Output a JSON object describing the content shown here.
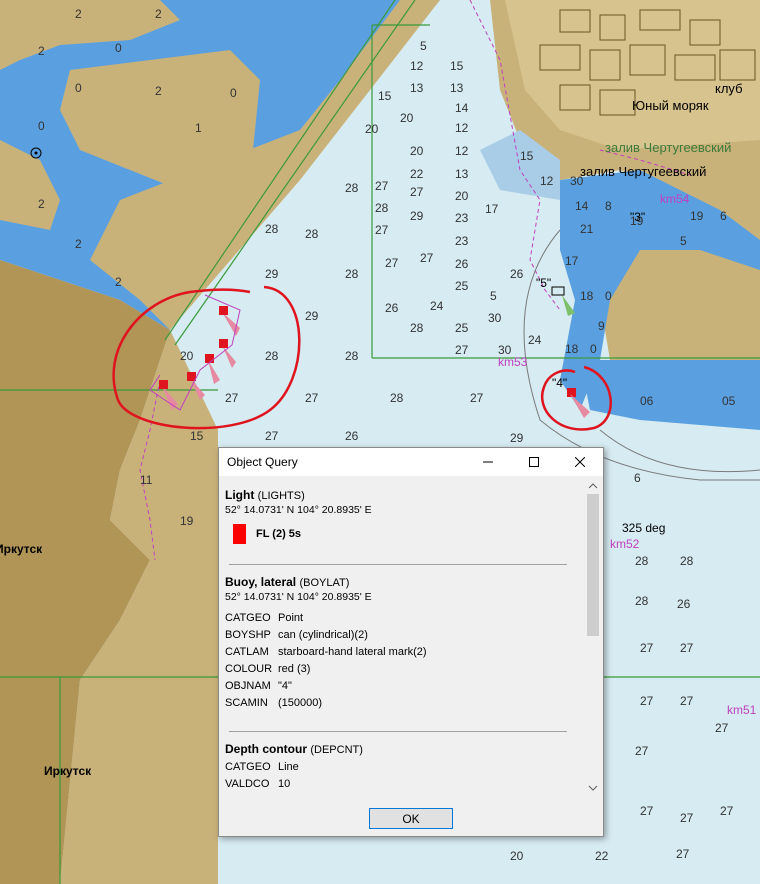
{
  "map": {
    "city_label": "Иркутск",
    "bearing_label": "325 deg",
    "buoy_label": "\"4\"",
    "buoy_label_2": "\"5\"",
    "buoy_label_3": "\"3\"",
    "settlement_1": "Юный моряк",
    "settlement_2": "залив Чертугеевский",
    "settlement_3": "клуб",
    "km_labels": [
      "km54",
      "km53",
      "km52",
      "km51"
    ],
    "colors": {
      "water_deep": "#d6ebf2",
      "water_shallow": "#5aa0e0",
      "land": "#c9b27a",
      "urban": "#b09556",
      "annotation_red": "#e0141e",
      "magenta": "#c040c0",
      "grid_green": "#3a9a3a"
    }
  },
  "dialog": {
    "title": "Object Query",
    "ok_label": "OK",
    "sections": [
      {
        "name": "Light",
        "class": "(LIGHTS)",
        "coord": "52° 14.0731' N 104° 20.8935' E",
        "light_text": "FL (2) 5s",
        "light_color": "#ff0000"
      },
      {
        "name": "Buoy, lateral",
        "class": "(BOYLAT)",
        "coord": "52° 14.0731' N 104° 20.8935' E",
        "attrs": [
          {
            "k": "CATGEO",
            "v": "Point"
          },
          {
            "k": "BOYSHP",
            "v": "can (cylindrical)(2)"
          },
          {
            "k": "CATLAM",
            "v": "starboard-hand lateral mark(2)"
          },
          {
            "k": "COLOUR",
            "v": "red (3)"
          },
          {
            "k": "OBJNAM",
            "v": "\"4\""
          },
          {
            "k": "SCAMIN",
            "v": "(150000)"
          }
        ]
      },
      {
        "name": "Depth contour",
        "class": "(DEPCNT)",
        "attrs": [
          {
            "k": "CATGEO",
            "v": "Line"
          },
          {
            "k": "VALDCO",
            "v": "10"
          }
        ]
      }
    ]
  }
}
